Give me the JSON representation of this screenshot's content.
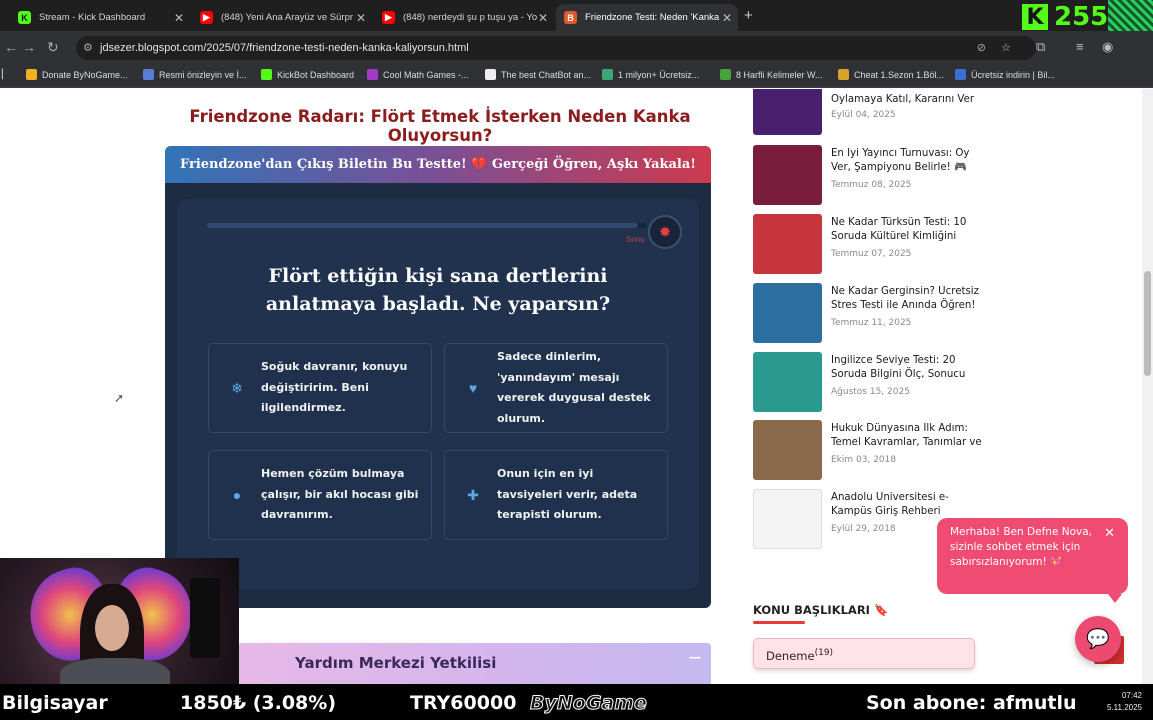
{
  "browser": {
    "tabs": [
      {
        "title": "Stream - Kick Dashboard",
        "icon": "kick-icon"
      },
      {
        "title": "(848) Yeni Ana Arayüz ve Sürpr",
        "icon": "youtube-icon"
      },
      {
        "title": "(848) nerdeydi şu p tuşu ya - Yo",
        "icon": "youtube-icon"
      },
      {
        "title": "Friendzone Testi: Neden 'Kanka",
        "icon": "blogger-icon"
      }
    ],
    "url": "jdsezer.blogspot.com/2025/07/friendzone-testi-neden-kanka-kaliyorsun.html",
    "bookmarks": [
      "Donate ByNoGame...",
      "Resmi önizleyin ve İ...",
      "KickBot Dashboard",
      "Cool Math Games -...",
      "The best ChatBot an...",
      "1 milyon+ Ücretsiz...",
      "8 Harfli Kelimeler W...",
      "Cheat 1.Sezon 1.Böl...",
      "Ücretsiz indirin | Bil..."
    ]
  },
  "overlay": {
    "kick_letter": "K",
    "kick_count": "255"
  },
  "quiz": {
    "title": "Friendzone Radarı: Flört Etmek İsterken Neden Kanka Oluyorsun?",
    "header": "Friendzone'dan Çıkış Biletin Bu Testte! 💔 Gerçeği Öğren, Aşkı Yakala!",
    "progress": 0.98,
    "timer_label": "Sonu",
    "question": "Flört ettiğin kişi sana dertlerini anlatmaya başladı. Ne yaparsın?",
    "options": [
      "Soğuk davranır, konuyu değiştiririm. Beni ilgilendirmez.",
      "Sadece dinlerim, 'yanındayım' mesajı vererek duygusal destek olurum.",
      "Hemen çözüm bulmaya çalışır, bir akıl hocası gibi davranırım.",
      "Onun için en iyi tavsiyeleri verir, adeta terapisti olurum."
    ]
  },
  "help_bar": {
    "title": "Yardım Merkezi Yetkilisi",
    "minimize": "—"
  },
  "sidebar": {
    "posts": [
      {
        "title": "Oylamaya Katıl, Kararını Ver",
        "date": "Eylül 04, 2025",
        "thumb": "#4a1f6e"
      },
      {
        "title": "En İyi Yayıncı Turnuvası: Oy Ver, Şampiyonu Belirle! 🎮",
        "date": "Temmuz 08, 2025",
        "thumb": "#7a1c3c"
      },
      {
        "title": "Ne Kadar Türksün Testi: 10 Soruda Kültürel Kimliğini",
        "date": "Temmuz 07, 2025",
        "thumb": "#c8343b"
      },
      {
        "title": "Ne Kadar Gerginsin? Ücretsiz Stres Testi ile Anında Öğren!",
        "date": "Temmuz 11, 2025",
        "thumb": "#2d6ea0"
      },
      {
        "title": "İngilizce Seviye Testi: 20 Soruda Bilgini Ölç, Sonucu",
        "date": "Ağustos 15, 2025",
        "thumb": "#2a9a8f"
      },
      {
        "title": "Hukuk Dünyasına İlk Adım: Temel Kavramlar, Tanımlar ve",
        "date": "Ekim 03, 2018",
        "thumb": "#8a6a4a"
      },
      {
        "title": "Anadolu Üniversitesi e-Kampüs Giriş Rehberi",
        "date": "Eylül 29, 2018",
        "thumb": "#f4f4f4"
      }
    ],
    "topics_heading": "KONU BAŞLIKLARI 🔖",
    "topic": {
      "name": "Deneme",
      "count": "(19)"
    }
  },
  "chat": {
    "message": "Merhaba! Ben Defne Nova, sizinle sohbet etmek için sabırsızlanıyorum! 💖",
    "close": "✕"
  },
  "ticker": {
    "items": [
      "Bilgisayar",
      "1850₺ (3.08%)",
      "TRY60000",
      "ByNoGame",
      "Son abone: afmutlu"
    ]
  },
  "clock": {
    "time": "07:42",
    "date": "5.11.2025"
  },
  "colors": {
    "accent": "#f04b73",
    "quiz_bg": "#1d2b43",
    "kick_green": "#53fc18"
  }
}
